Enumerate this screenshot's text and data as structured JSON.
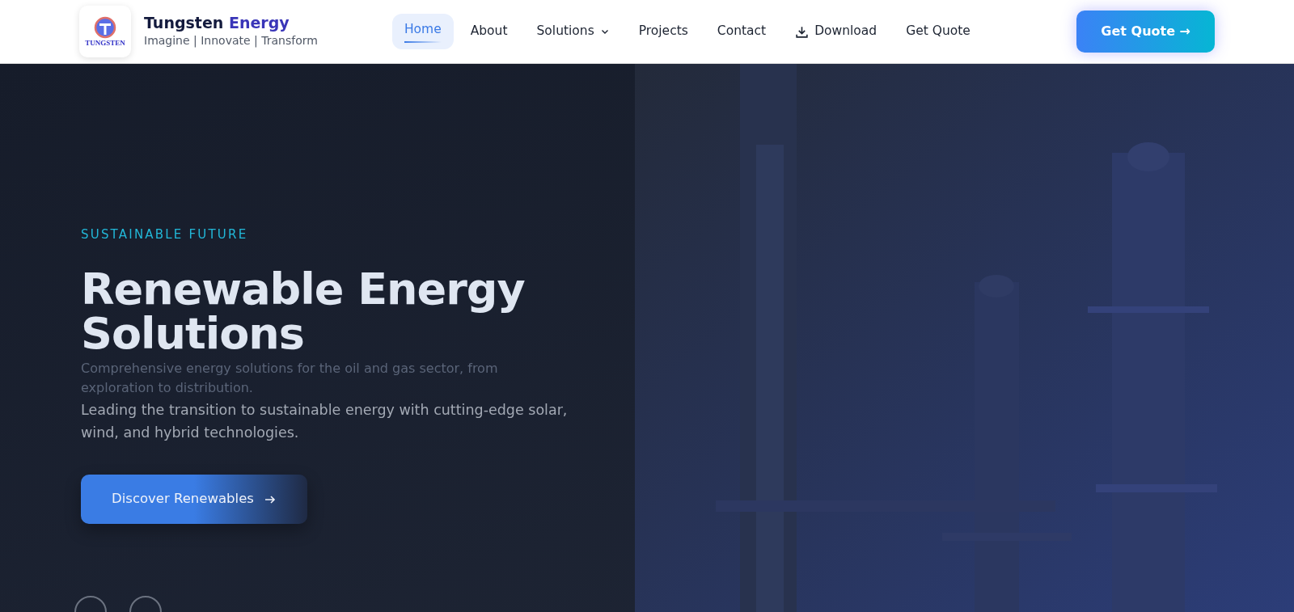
{
  "navbar": {
    "logo_text": "TUNGSTEN",
    "brand": {
      "name": "Tungsten",
      "accent": "Energy"
    },
    "tagline": "Imagine | Innovate | Transform",
    "items": [
      {
        "label": "Home",
        "kind": "link",
        "selected": true
      },
      {
        "label": "About",
        "kind": "link",
        "selected": false
      },
      {
        "label": "Solutions",
        "kind": "dropdown",
        "selected": false
      },
      {
        "label": "Projects",
        "kind": "link",
        "selected": false
      },
      {
        "label": "Contact",
        "kind": "link",
        "selected": false
      },
      {
        "label": "Download",
        "kind": "download",
        "selected": false
      },
      {
        "label": "Get Quote",
        "kind": "link",
        "selected": false
      }
    ],
    "cta": "Get Quote →"
  },
  "hero": {
    "eyebrow": "SUSTAINABLE FUTURE",
    "title": "Renewable Energy Solutions",
    "fading_text": "Comprehensive energy solutions for the oil and gas sector, from exploration to distribution.",
    "subtitle": "Leading the transition to sustainable energy with cutting-edge solar, wind, and hybrid technologies.",
    "button": "Discover Renewables"
  }
}
